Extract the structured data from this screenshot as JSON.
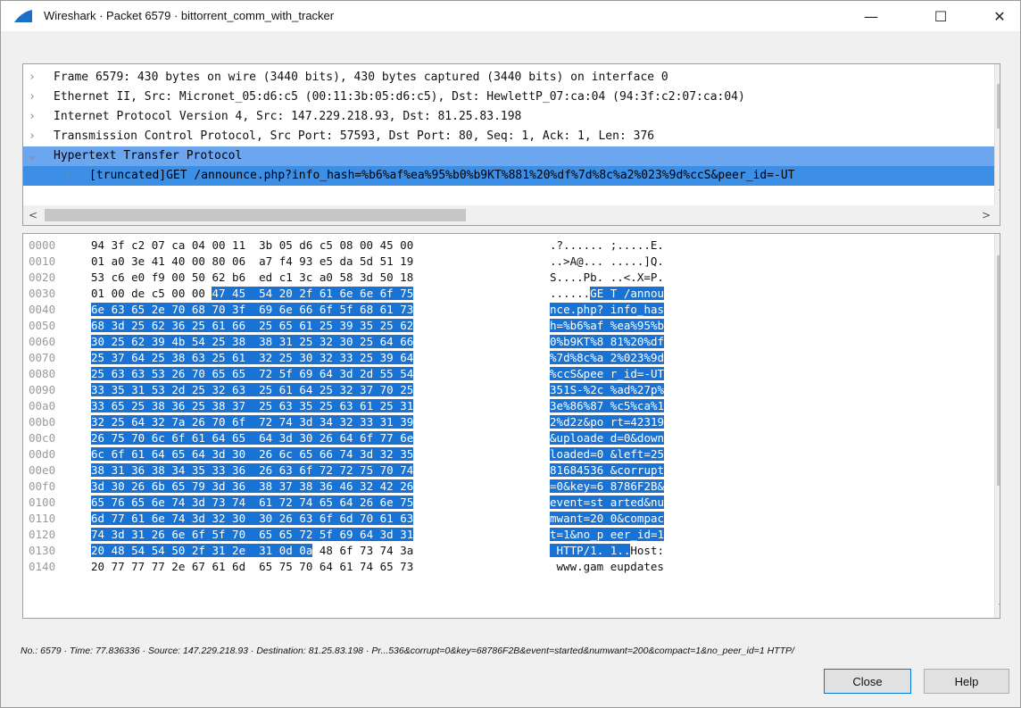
{
  "window": {
    "title": "Wireshark · Packet 6579 · bittorrent_comm_with_tracker",
    "icon": "wireshark-fin-icon",
    "min_glyph": "—",
    "max_glyph": "☐",
    "close_glyph": "✕"
  },
  "tree": {
    "rows": [
      {
        "arrow": ">",
        "text": "Frame 6579: 430 bytes on wire (3440 bits), 430 bytes captured (3440 bits) on interface 0"
      },
      {
        "arrow": ">",
        "text": "Ethernet II, Src: Micronet_05:d6:c5 (00:11:3b:05:d6:c5), Dst: HewlettP_07:ca:04 (94:3f:c2:07:ca:04)"
      },
      {
        "arrow": ">",
        "text": "Internet Protocol Version 4, Src: 147.229.218.93, Dst: 81.25.83.198"
      },
      {
        "arrow": ">",
        "text": "Transmission Control Protocol, Src Port: 57593, Dst Port: 80, Seq: 1, Ack: 1, Len: 376"
      },
      {
        "arrow": "v",
        "text": "Hypertext Transfer Protocol"
      },
      {
        "arrow": ">",
        "text": "[truncated]GET /announce.php?info_hash=%b6%af%ea%95%b0%b9KT%881%20%df%7d%8c%a2%023%9d%ccS&peer_id=-UT"
      }
    ]
  },
  "hex": {
    "rows": [
      {
        "off": "0000",
        "b1": "94 3f c2 07 ca 04 00 11",
        "b2": "3b 05 d6 c5 08 00 45 00",
        "a1": ".?......",
        "a2": ";.....E.",
        "hl": "none"
      },
      {
        "off": "0010",
        "b1": "01 a0 3e 41 40 00 80 06",
        "b2": "a7 f4 93 e5 da 5d 51 19",
        "a1": "..>A@...",
        "a2": ".....]Q.",
        "hl": "none"
      },
      {
        "off": "0020",
        "b1": "53 c6 e0 f9 00 50 62 b6",
        "b2": "ed c1 3c a0 58 3d 50 18",
        "a1": "S....Pb.",
        "a2": "..<.X=P.",
        "hl": "none"
      },
      {
        "off": "0030",
        "b1": "01 00 de c5 00 00 47 45",
        "b2": "54 20 2f 61 6e 6e 6f 75",
        "a1": "......GE",
        "a2": "T /annou",
        "hl": "partial-start"
      },
      {
        "off": "0040",
        "b1": "6e 63 65 2e 70 68 70 3f",
        "b2": "69 6e 66 6f 5f 68 61 73",
        "a1": "nce.php?",
        "a2": "info_has",
        "hl": "full"
      },
      {
        "off": "0050",
        "b1": "68 3d 25 62 36 25 61 66",
        "b2": "25 65 61 25 39 35 25 62",
        "a1": "h=%b6%af",
        "a2": "%ea%95%b",
        "hl": "full"
      },
      {
        "off": "0060",
        "b1": "30 25 62 39 4b 54 25 38",
        "b2": "38 31 25 32 30 25 64 66",
        "a1": "0%b9KT%8",
        "a2": "81%20%df",
        "hl": "full"
      },
      {
        "off": "0070",
        "b1": "25 37 64 25 38 63 25 61",
        "b2": "32 25 30 32 33 25 39 64",
        "a1": "%7d%8c%a",
        "a2": "2%023%9d",
        "hl": "full"
      },
      {
        "off": "0080",
        "b1": "25 63 63 53 26 70 65 65",
        "b2": "72 5f 69 64 3d 2d 55 54",
        "a1": "%ccS&pee",
        "a2": "r_id=-UT",
        "hl": "full"
      },
      {
        "off": "0090",
        "b1": "33 35 31 53 2d 25 32 63",
        "b2": "25 61 64 25 32 37 70 25",
        "a1": "351S-%2c",
        "a2": "%ad%27p%",
        "hl": "full"
      },
      {
        "off": "00a0",
        "b1": "33 65 25 38 36 25 38 37",
        "b2": "25 63 35 25 63 61 25 31",
        "a1": "3e%86%87",
        "a2": "%c5%ca%1",
        "hl": "full"
      },
      {
        "off": "00b0",
        "b1": "32 25 64 32 7a 26 70 6f",
        "b2": "72 74 3d 34 32 33 31 39",
        "a1": "2%d2z&po",
        "a2": "rt=42319",
        "hl": "full"
      },
      {
        "off": "00c0",
        "b1": "26 75 70 6c 6f 61 64 65",
        "b2": "64 3d 30 26 64 6f 77 6e",
        "a1": "&uploade",
        "a2": "d=0&down",
        "hl": "full"
      },
      {
        "off": "00d0",
        "b1": "6c 6f 61 64 65 64 3d 30",
        "b2": "26 6c 65 66 74 3d 32 35",
        "a1": "loaded=0",
        "a2": "&left=25",
        "hl": "full"
      },
      {
        "off": "00e0",
        "b1": "38 31 36 38 34 35 33 36",
        "b2": "26 63 6f 72 72 75 70 74",
        "a1": "81684536",
        "a2": "&corrupt",
        "hl": "full"
      },
      {
        "off": "00f0",
        "b1": "3d 30 26 6b 65 79 3d 36",
        "b2": "38 37 38 36 46 32 42 26",
        "a1": "=0&key=6",
        "a2": "8786F2B&",
        "hl": "full"
      },
      {
        "off": "0100",
        "b1": "65 76 65 6e 74 3d 73 74",
        "b2": "61 72 74 65 64 26 6e 75",
        "a1": "event=st",
        "a2": "arted&nu",
        "hl": "full"
      },
      {
        "off": "0110",
        "b1": "6d 77 61 6e 74 3d 32 30",
        "b2": "30 26 63 6f 6d 70 61 63",
        "a1": "mwant=20",
        "a2": "0&compac",
        "hl": "full"
      },
      {
        "off": "0120",
        "b1": "74 3d 31 26 6e 6f 5f 70",
        "b2": "65 65 72 5f 69 64 3d 31",
        "a1": "t=1&no_p",
        "a2": "eer_id=1",
        "hl": "full"
      },
      {
        "off": "0130",
        "b1": "20 48 54 54 50 2f 31 2e",
        "b2": "31 0d 0a 48 6f 73 74 3a",
        "a1": " HTTP/1.",
        "a2": "1..Host:",
        "hl": "partial-end"
      },
      {
        "off": "0140",
        "b1": "20 77 77 77 2e 67 61 6d",
        "b2": "65 75 70 64 61 74 65 73",
        "a1": " www.gam",
        "a2": "eupdates",
        "hl": "none"
      }
    ]
  },
  "status": "No.: 6579 · Time: 77.836336 · Source: 147.229.218.93 · Destination: 81.25.83.198 · Pr...536&corrupt=0&key=68786F2B&event=started&numwant=200&compact=1&no_peer_id=1 HTTP/",
  "buttons": {
    "close": "Close",
    "help": "Help"
  },
  "colors": {
    "selection": "#1873d4",
    "tree_selected": "#6ba6ee"
  }
}
